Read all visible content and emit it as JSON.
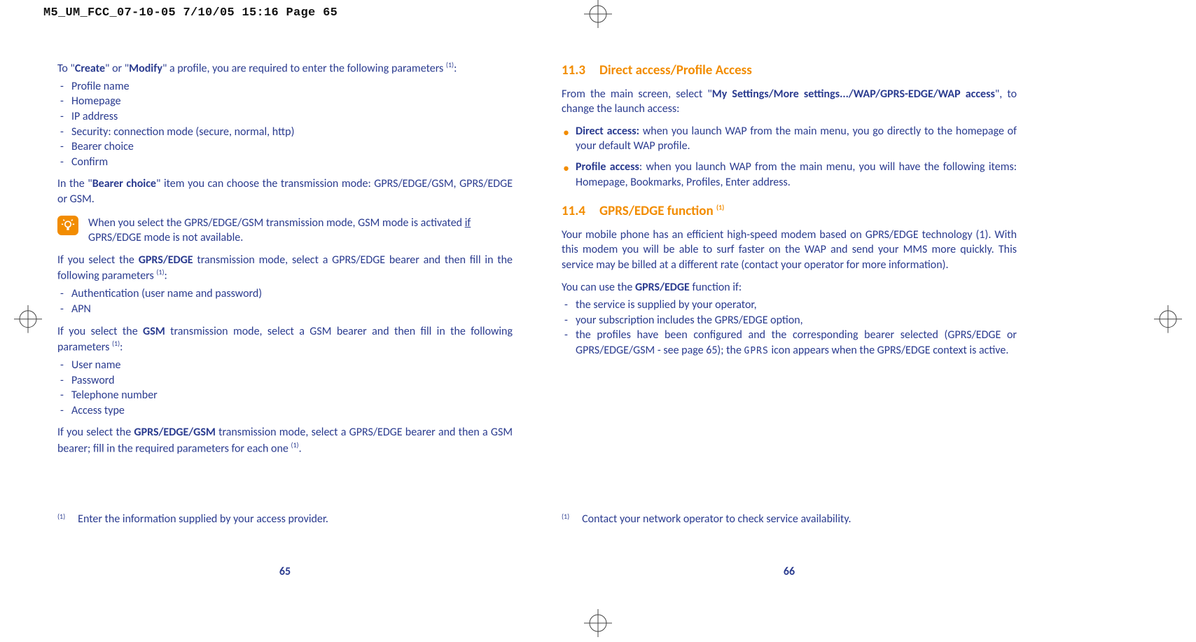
{
  "header_line": "M5_UM_FCC_07-10-05  7/10/05  15:16  Page 65",
  "left": {
    "intro_pre": "To \"",
    "intro_b1": "Create",
    "intro_mid": "\" or \"",
    "intro_b2": "Modify",
    "intro_post": "\" a profile, you are required to enter the following parameters ",
    "params": [
      "Profile name",
      "Homepage",
      "IP address",
      "Security: connection mode (secure, normal, http)",
      "Bearer choice",
      "Confirm"
    ],
    "bearer_pre": "In the \"",
    "bearer_b": "Bearer choice",
    "bearer_post": "\" item you can choose the transmission mode: GPRS/EDGE/GSM, GPRS/EDGE or GSM.",
    "tip_pre": "When you select the GPRS/EDGE/GSM transmission mode, GSM mode is activated ",
    "tip_if": "if",
    "tip_post": " GPRS/EDGE mode is not available.",
    "gprs_sel_pre": "If you select the ",
    "gprs_sel_b": "GPRS/EDGE",
    "gprs_sel_post": " transmission mode, select a GPRS/EDGE bearer and then fill in the following parameters ",
    "gprs_params": [
      "Authentication (user name and password)",
      "APN"
    ],
    "gsm_sel_pre": "If you select the ",
    "gsm_sel_b": "GSM",
    "gsm_sel_post": " transmission mode, select a GSM bearer and then fill in the following parameters ",
    "gsm_params": [
      "User name",
      "Password",
      "Telephone number",
      "Access type"
    ],
    "both_pre": "If you select the ",
    "both_b": "GPRS/EDGE/GSM",
    "both_post": " transmission mode, select a GPRS/EDGE bearer and then a GSM bearer; fill in the required parameters for each one ",
    "footnote": "Enter the information supplied by your access provider.",
    "page_num": "65"
  },
  "right": {
    "h1_num": "11.3",
    "h1_text": "Direct access/Profile Access",
    "p1_pre": "From the main screen, select \"",
    "p1_b": "My Settings/More settings.../WAP/GPRS-EDGE/WAP access",
    "p1_post": "\", to change the launch access:",
    "access_items": {
      "da_b": "Direct access:",
      "da_t": " when you launch WAP from the main menu, you go directly to the homepage of your default WAP profile.",
      "pa_b": "Profile access",
      "pa_t": ": when you launch WAP from the main menu, you will have the following items: Homepage, Bookmarks, Profiles, Enter address."
    },
    "h2_num": "11.4",
    "h2_text": "GPRS/EDGE function ",
    "p2": "Your mobile phone has an efficient high-speed modem based on GPRS/EDGE technology (1). With this modem you will be able to surf faster on the WAP and send your MMS more quickly. This service may be billed at a different rate (contact your operator for more information).",
    "cond_pre": "You can use the ",
    "cond_b": "GPRS/EDGE",
    "cond_post": " function if:",
    "cond_items": {
      "c1": "the service is supplied by your operator,",
      "c2": "your subscription includes the GPRS/EDGE option,",
      "c3a": "the profiles have been configured and the corresponding bearer selected (GPRS/EDGE or GPRS/EDGE/GSM - see page 65); the ",
      "c3g": "GPRS",
      "c3b": " icon appears when the GPRS/EDGE context is active."
    },
    "footnote": "Contact your network operator to check service availability.",
    "page_num": "66"
  },
  "sup_marker": "(1)",
  "colon": ":",
  "period": "."
}
